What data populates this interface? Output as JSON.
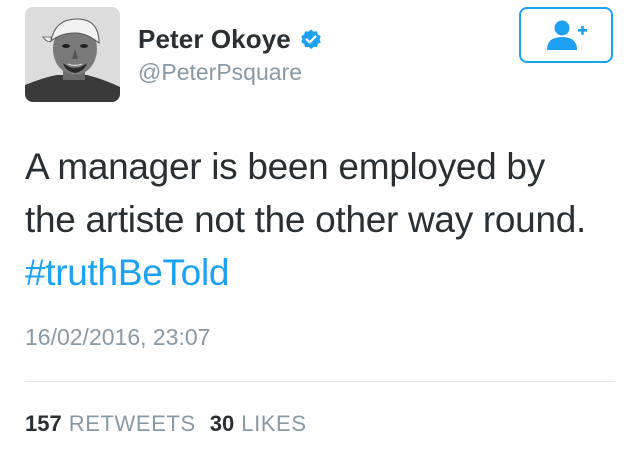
{
  "user": {
    "display_name": "Peter Okoye",
    "handle": "@PeterPsquare",
    "verified": true,
    "avatar_icon": "profile-photo"
  },
  "follow_button": {
    "icon": "add-user-icon",
    "color": "#1da1f2"
  },
  "tweet": {
    "text_line_1": "A manager is been employed by",
    "text_line_2": "the artiste not the other way round.",
    "hashtag": "#truthBeTold",
    "timestamp": "16/02/2016, 23:07"
  },
  "stats": {
    "retweets_count": "157",
    "retweets_label": "RETWEETS",
    "likes_count": "30",
    "likes_label": "LIKES"
  },
  "colors": {
    "accent": "#1da1f2",
    "text": "#292f33",
    "secondary_text": "#8899a6",
    "divider": "#e1e8ed"
  }
}
